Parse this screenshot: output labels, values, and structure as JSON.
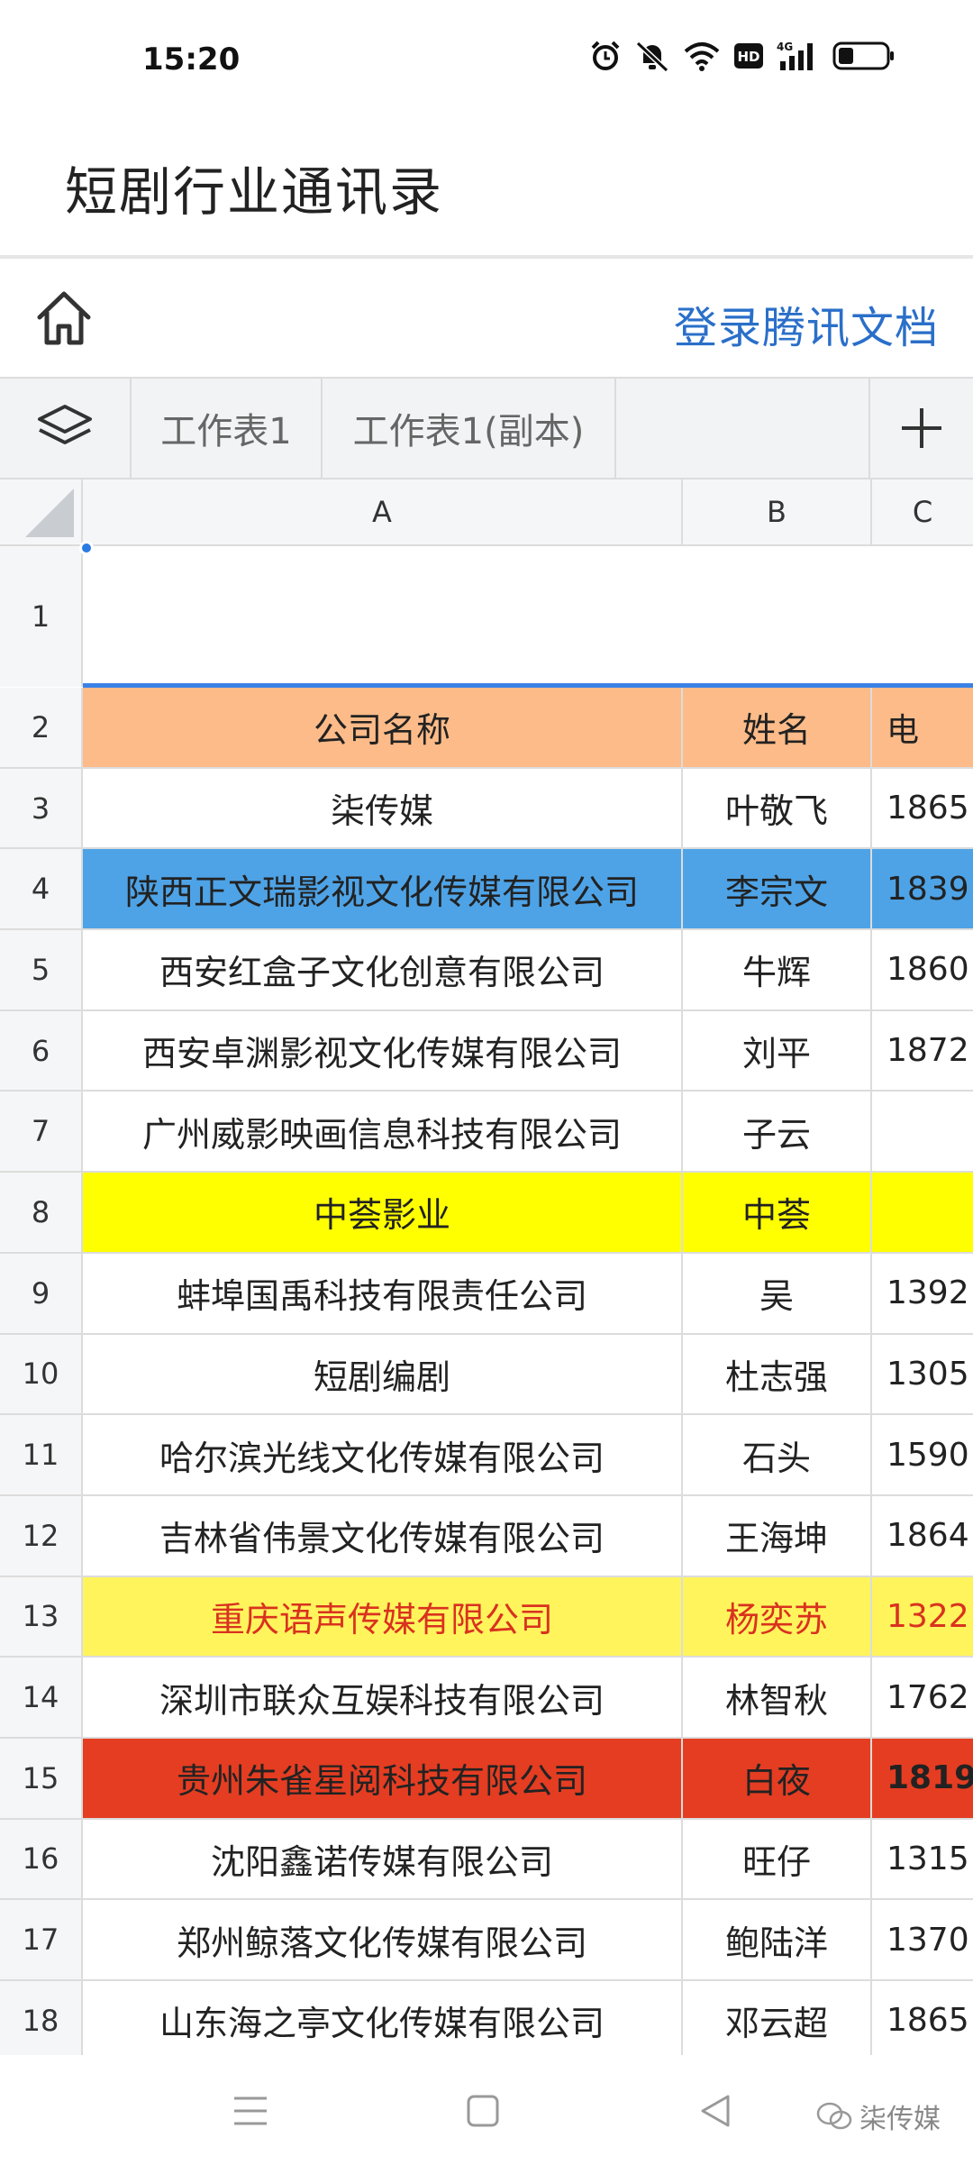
{
  "status_bar": {
    "time": "15:20",
    "icons": [
      "alarm-icon",
      "mute-icon",
      "wifi-icon",
      "hd-icon",
      "signal-4g-icon",
      "battery-icon"
    ],
    "hd_label": "HD",
    "network_label": "4G"
  },
  "app": {
    "title": "短剧行业通讯录",
    "login_link": "登录腾讯文档"
  },
  "sheet_tabs": [
    {
      "label": "工作表1"
    },
    {
      "label": "工作表1(副本)"
    }
  ],
  "columns": [
    "A",
    "B",
    "C"
  ],
  "rows": [
    {
      "num": "1",
      "a": "",
      "b": "",
      "c": "",
      "style": "empty"
    },
    {
      "num": "2",
      "a": "公司名称",
      "b": "姓名",
      "c": "电",
      "style": "header"
    },
    {
      "num": "3",
      "a": "柒传媒",
      "b": "叶敬飞",
      "c": "1865",
      "style": "normal"
    },
    {
      "num": "4",
      "a": "陕西正文瑞影视文化传媒有限公司",
      "b": "李宗文",
      "c": "1839",
      "style": "blue"
    },
    {
      "num": "5",
      "a": "西安红盒子文化创意有限公司",
      "b": "牛辉",
      "c": "1860",
      "style": "normal"
    },
    {
      "num": "6",
      "a": "西安卓渊影视文化传媒有限公司",
      "b": "刘平",
      "c": "1872",
      "style": "normal"
    },
    {
      "num": "7",
      "a": "广州威影映画信息科技有限公司",
      "b": "子云",
      "c": "",
      "style": "normal"
    },
    {
      "num": "8",
      "a": "中荟影业",
      "b": "中荟",
      "c": "",
      "style": "yellow"
    },
    {
      "num": "9",
      "a": "蚌埠国禹科技有限责任公司",
      "b": "吴",
      "c": "1392",
      "style": "normal"
    },
    {
      "num": "10",
      "a": "短剧编剧",
      "b": "杜志强",
      "c": "1305",
      "style": "normal"
    },
    {
      "num": "11",
      "a": "哈尔滨光线文化传媒有限公司",
      "b": "石头",
      "c": "1590",
      "style": "normal"
    },
    {
      "num": "12",
      "a": "吉林省伟景文化传媒有限公司",
      "b": "王海坤",
      "c": "1864",
      "style": "normal"
    },
    {
      "num": "13",
      "a": "重庆语声传媒有限公司",
      "b": "杨奕苏",
      "c": "1322",
      "style": "lightyellow"
    },
    {
      "num": "14",
      "a": "深圳市联众互娱科技有限公司",
      "b": "林智秋",
      "c": "1762",
      "style": "normal"
    },
    {
      "num": "15",
      "a": "贵州朱雀星阅科技有限公司",
      "b": "白夜",
      "c": "1819",
      "style": "red"
    },
    {
      "num": "16",
      "a": "沈阳鑫诺传媒有限公司",
      "b": "旺仔",
      "c": "1315",
      "style": "normal"
    },
    {
      "num": "17",
      "a": "郑州鲸落文化传媒有限公司",
      "b": "鲍陆洋",
      "c": "1370",
      "style": "normal"
    },
    {
      "num": "18",
      "a": "山东海之亭文化传媒有限公司",
      "b": "邓云超",
      "c": "1865",
      "style": "normal"
    }
  ],
  "watermark": "柒传媒",
  "colors": {
    "header_orange": "#fcbb88",
    "row_blue": "#4ea3e6",
    "row_yellow": "#ffff00",
    "row_light_yellow": "#fff45c",
    "row_red": "#e43d22",
    "text_red": "#d9321f",
    "link_blue": "#2a6fc9",
    "selection_blue": "#3b82e6"
  }
}
